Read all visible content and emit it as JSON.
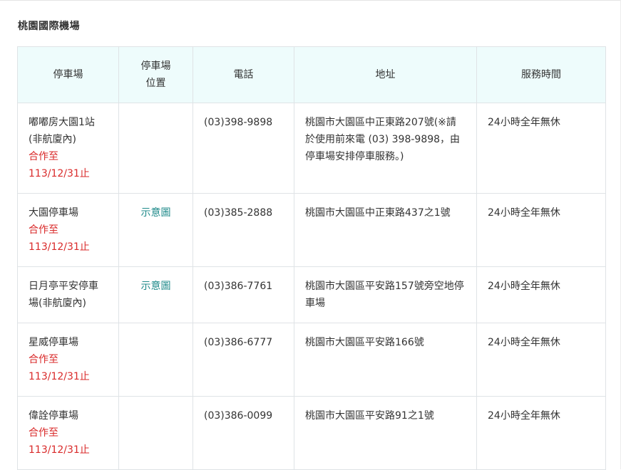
{
  "section_title": "桃園國際機場",
  "headers": [
    "停車場",
    "停車場\n位置",
    "電話",
    "地址",
    "服務時間"
  ],
  "headers_split": {
    "h2_line1": "停車場",
    "h2_line2": "位置"
  },
  "rows": [
    {
      "name_lines": [
        "嘟嘟房大園1站",
        "(非航廈內)"
      ],
      "contract_line1": "合作至",
      "contract_line2": "113/12/31止",
      "map": "",
      "phone": "(03)398-9898",
      "address": "桃園市大園區中正東路207號(※請於使用前來電 (03) 398-9898，由停車場安排停車服務。)",
      "hours": "24小時全年無休"
    },
    {
      "name_lines": [
        "大園停車場"
      ],
      "contract_line1": "合作至",
      "contract_line2": "113/12/31止",
      "map": "示意圖",
      "phone": "(03)385-2888",
      "address": "桃園市大園區中正東路437之1號",
      "hours": "24小時全年無休"
    },
    {
      "name_lines": [
        "日月亭平安停車場(非航廈內)"
      ],
      "contract_line1": "",
      "contract_line2": "",
      "map": "示意圖",
      "phone": "(03)386-7761",
      "address": "桃園市大園區平安路157號旁空地停車場",
      "hours": "24小時全年無休"
    },
    {
      "name_lines": [
        "星威停車場"
      ],
      "contract_line1": "合作至",
      "contract_line2": "113/12/31止",
      "map": "",
      "phone": "(03)386-6777",
      "address": "桃園市大園區平安路166號",
      "hours": "24小時全年無休"
    },
    {
      "name_lines": [
        "偉詮停車場"
      ],
      "contract_line1": "合作至",
      "contract_line2": "113/12/31止",
      "map": "",
      "phone": "(03)386-0099",
      "address": "桃園市大園區平安路91之1號",
      "hours": "24小時全年無休"
    }
  ],
  "colors": {
    "header_bg": "#eefcfc",
    "contract_red": "#d92a2a",
    "link_teal": "#1f8a8a",
    "border": "#dfe3e6"
  }
}
